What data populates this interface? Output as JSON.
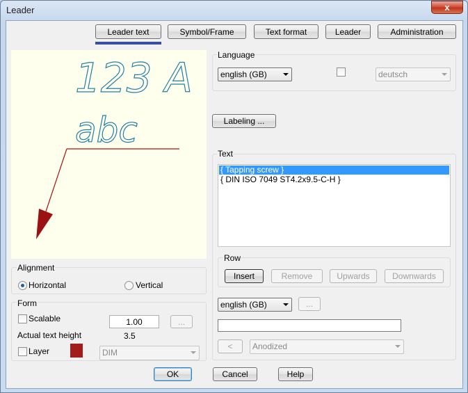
{
  "window": {
    "title": "Leader",
    "close_glyph": "x"
  },
  "tabs": [
    "Leader text",
    "Symbol/Frame",
    "Text format",
    "Leader",
    "Administration"
  ],
  "preview": {
    "line1": "123 A",
    "line2": "abc",
    "leader_color": "#aa1111",
    "text_color": "#1f7fa6"
  },
  "alignment": {
    "label": "Alignment",
    "horizontal": "Horizontal",
    "vertical": "Vertical",
    "selected": "Horizontal"
  },
  "form": {
    "label": "Form",
    "scalable_label": "Scalable",
    "scalable_value": "1.00",
    "dots_button": "...",
    "actual_height_label": "Actual text height",
    "actual_height_value": "3.5",
    "layer_label": "Layer",
    "layer_color": "#a31c1c",
    "layer_value": "DIM"
  },
  "language": {
    "label": "Language",
    "primary": "english (GB)",
    "secondary": "deutsch"
  },
  "labeling_button": "Labeling ...",
  "text": {
    "label": "Text",
    "items": [
      "{ Tapping screw }",
      "{ DIN ISO 7049 ST4.2x9.5-C-H }"
    ],
    "selected_index": 0
  },
  "row": {
    "label": "Row",
    "insert": "Insert",
    "remove": "Remove",
    "upwards": "Upwards",
    "downwards": "Downwards"
  },
  "bottom": {
    "language": "english (GB)",
    "dots_button": "...",
    "text_field": "",
    "back_button": "<",
    "finish": "Anodized"
  },
  "footer": {
    "ok": "OK",
    "cancel": "Cancel",
    "help": "Help"
  }
}
